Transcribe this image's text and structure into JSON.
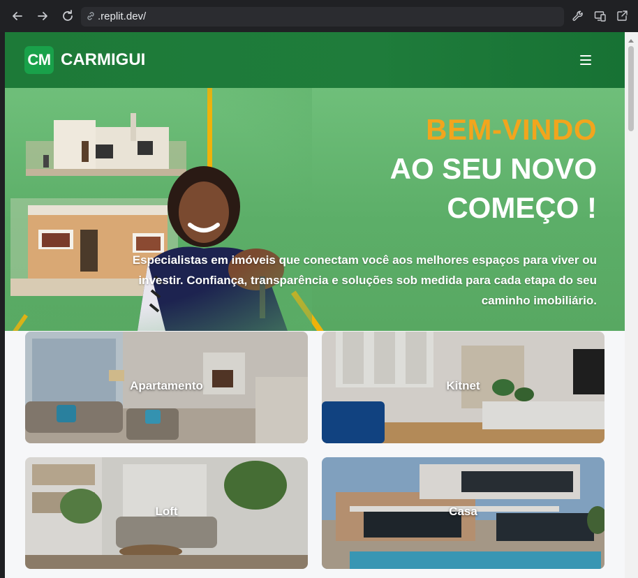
{
  "browser": {
    "url": ".replit.dev/",
    "back_icon": "arrow-left-icon",
    "forward_icon": "arrow-right-icon",
    "reload_icon": "reload-icon",
    "tools": [
      "wrench-icon",
      "devices-icon",
      "open-external-icon"
    ]
  },
  "header": {
    "logo": "CM",
    "brand": "CARMIGUI",
    "menu_icon": "hamburger-menu-icon"
  },
  "hero": {
    "title_line1": "BEM-VINDO",
    "title_line2": "AO SEU NOVO",
    "title_line3": "COMEÇO !",
    "subtitle": "Especialistas em imóveis que conectam você aos melhores espaços para viver ou investir. Confiança, transparência e soluções sob medida para cada etapa do seu caminho imobiliário.",
    "colors": {
      "accent": "#f2a51d",
      "green": "#5cae68",
      "stripe": "#f0b20a"
    }
  },
  "categories": [
    {
      "label": "Apartamento"
    },
    {
      "label": "Kitnet"
    },
    {
      "label": "Loft"
    },
    {
      "label": "Casa"
    }
  ],
  "colors": {
    "header_green": "#1d7a38",
    "logo_green": "#19a14a",
    "page_bg": "#f6f7f9"
  }
}
